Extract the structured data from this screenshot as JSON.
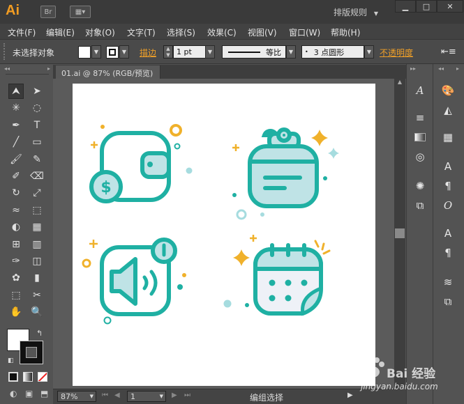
{
  "app": {
    "logo": "Ai",
    "bridge_label": "Br",
    "workspace": "排版规则",
    "window_controls": [
      "▁",
      "□",
      "✕"
    ]
  },
  "menu": [
    "文件(F)",
    "编辑(E)",
    "对象(O)",
    "文字(T)",
    "选择(S)",
    "效果(C)",
    "视图(V)",
    "窗口(W)",
    "帮助(H)"
  ],
  "control": {
    "selection_status": "未选择对象",
    "stroke_label": "描边",
    "stroke_value": "1 pt",
    "stroke_profile": "等比",
    "brush": "3 点圆形",
    "opacity_label": "不透明度"
  },
  "document": {
    "tab_title": "01.ai @ 87% (RGB/预览)"
  },
  "status": {
    "zoom": "87%",
    "page": "1",
    "text": "编组选择"
  },
  "watermark": {
    "brand": "Bai 经验",
    "url": "jingyan.baidu.com"
  },
  "colors": {
    "teal": "#1fb0a3",
    "teal_fill": "#bfe3e6",
    "teal_light": "#a6dcdf",
    "gold": "#f0b12b",
    "lavender": "#eef1f7",
    "ai_orange": "#f29c22"
  },
  "tools_left": [
    "selection-tool",
    "direct-selection-tool",
    "magic-wand-tool",
    "lasso-tool",
    "pen-tool",
    "type-tool",
    "line-tool",
    "rectangle-tool",
    "paintbrush-tool",
    "pencil-tool",
    "blob-brush-tool",
    "eraser-tool",
    "rotate-tool",
    "scale-tool",
    "width-tool",
    "free-transform-tool",
    "shape-builder-tool",
    "perspective-grid-tool",
    "mesh-tool",
    "gradient-tool",
    "eyedropper-tool",
    "blend-tool",
    "symbol-sprayer-tool",
    "column-graph-tool",
    "artboard-tool",
    "slice-tool",
    "hand-tool",
    "zoom-tool"
  ],
  "tools_glyphs": [
    "⮝",
    "➤",
    "✳",
    "◌",
    "✒",
    "T",
    "╱",
    "▭",
    "🖌",
    "✎",
    "✐",
    "⌫",
    "↻",
    "⤢",
    "≈",
    "⬚",
    "◐",
    "▦",
    "⊞",
    "▥",
    "✑",
    "◫",
    "✿",
    "▮",
    "⬚",
    "✂",
    "✋",
    "🔍"
  ]
}
